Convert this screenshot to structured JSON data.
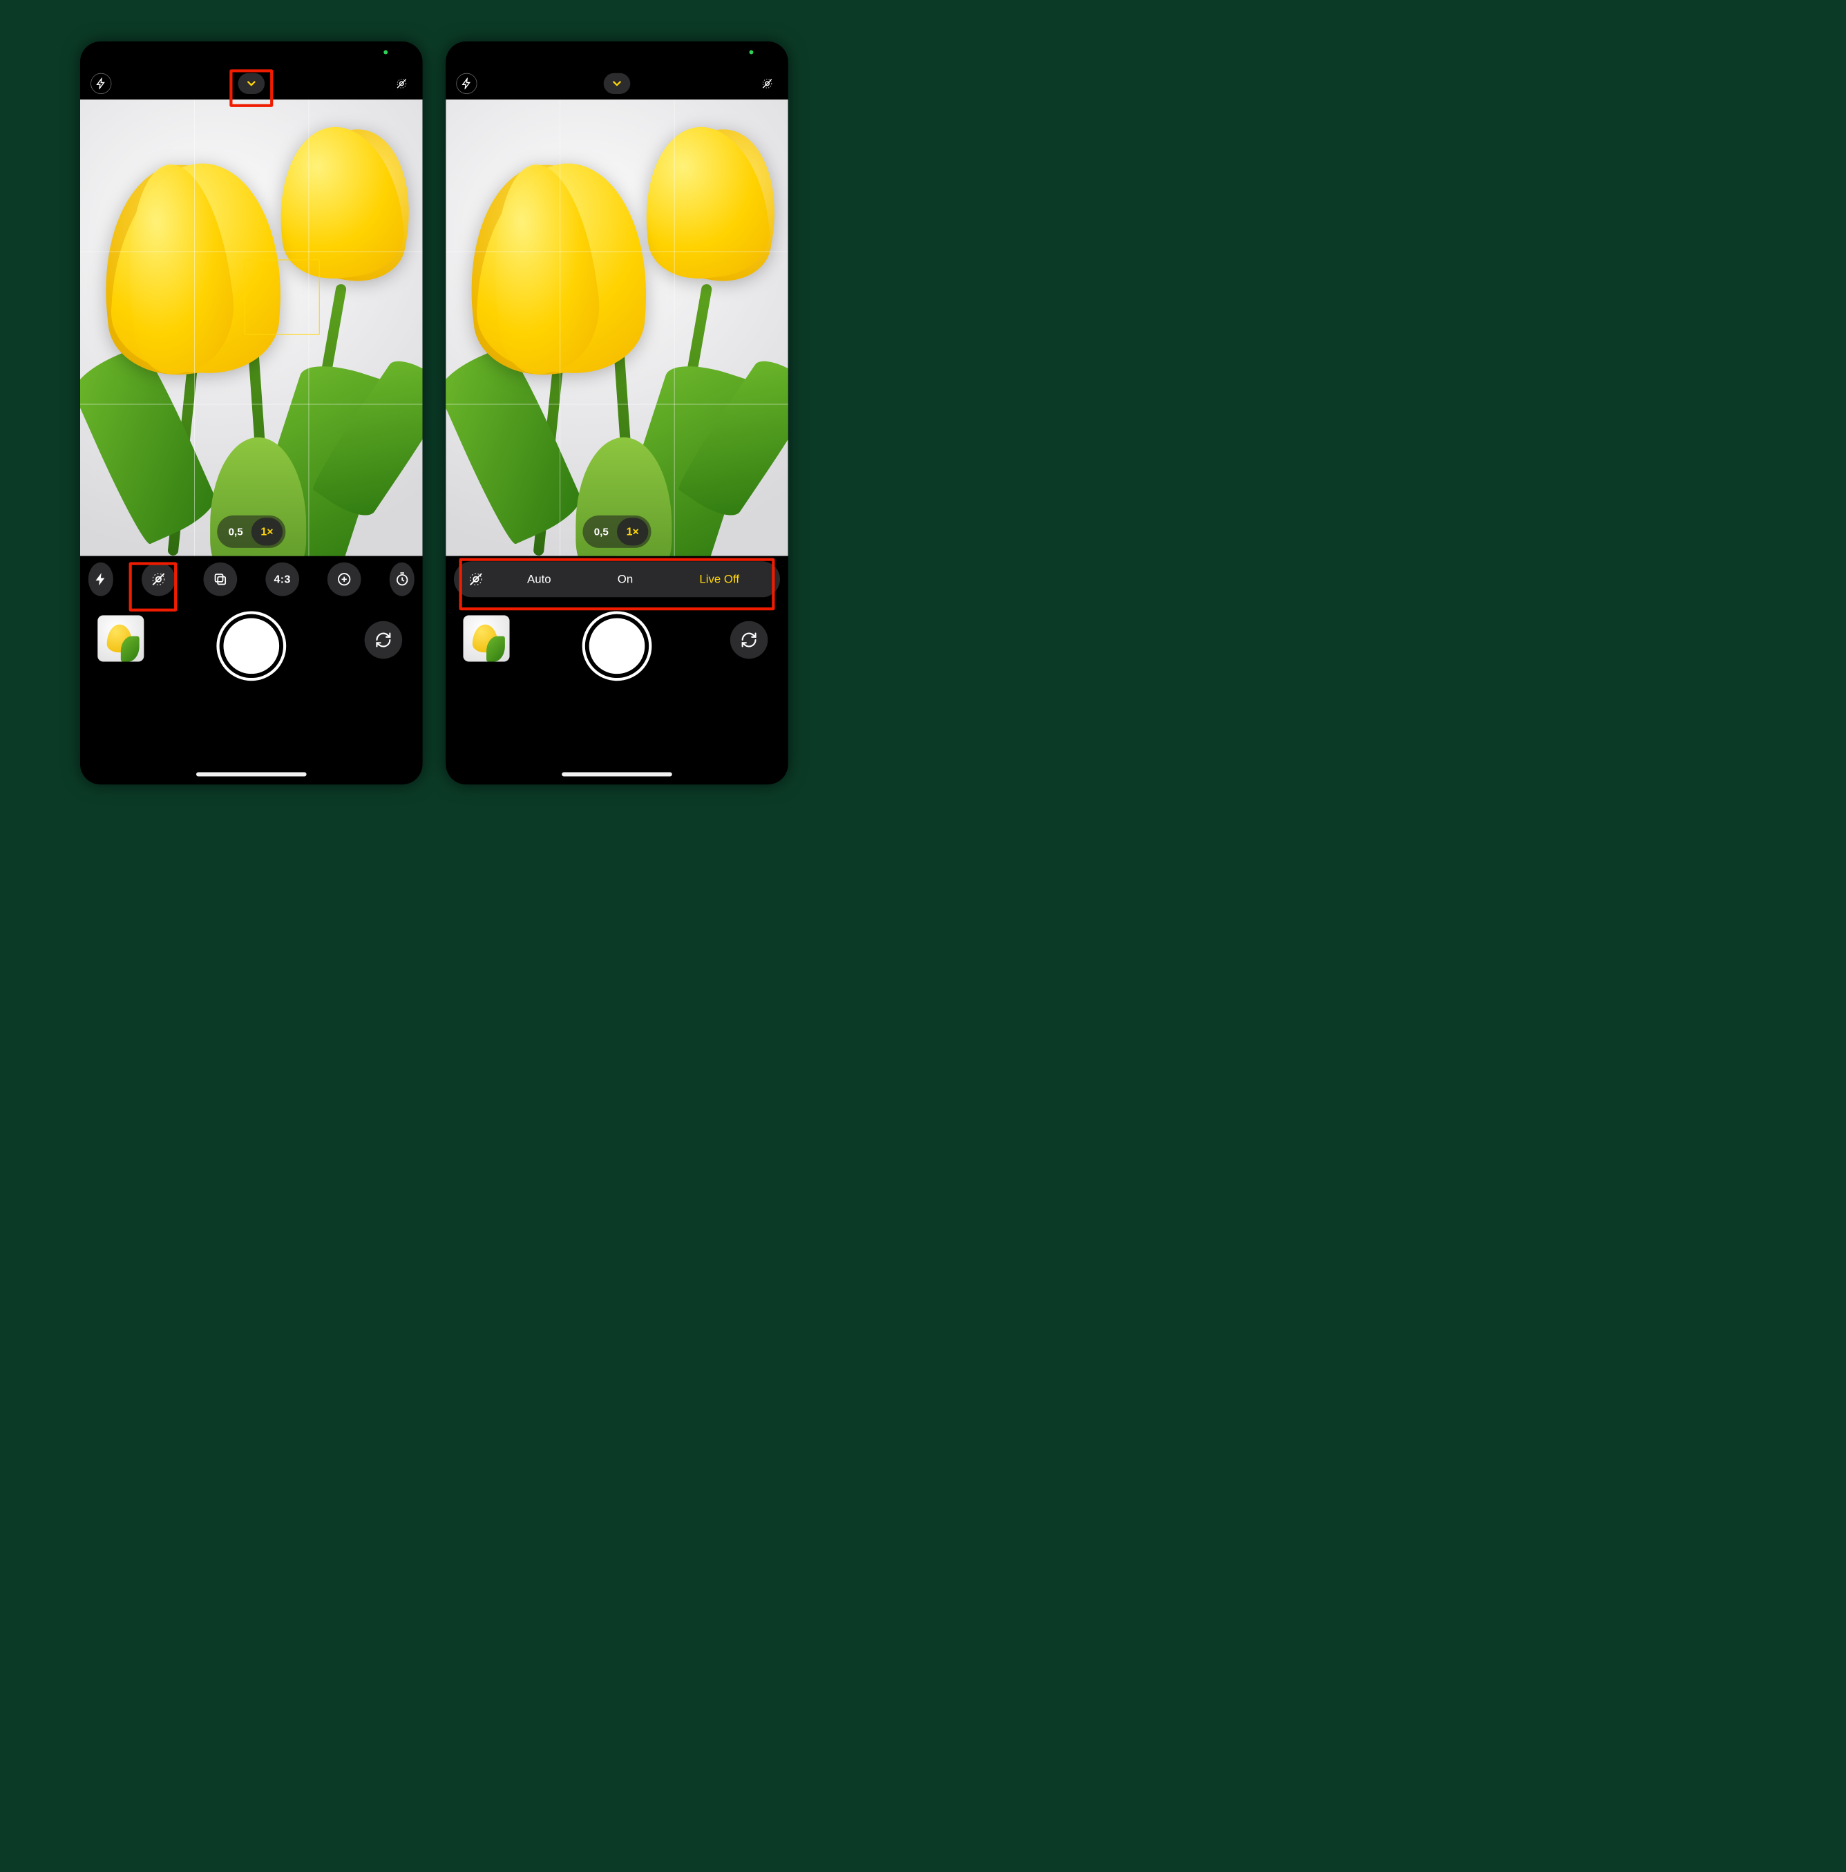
{
  "left": {
    "zoom": {
      "wide": "0,5",
      "default": "1×"
    },
    "tools": {
      "aspect": "4:3"
    }
  },
  "right": {
    "zoom": {
      "wide": "0,5",
      "default": "1×"
    },
    "live": {
      "opt_auto": "Auto",
      "opt_on": "On",
      "opt_off": "Live Off"
    }
  }
}
